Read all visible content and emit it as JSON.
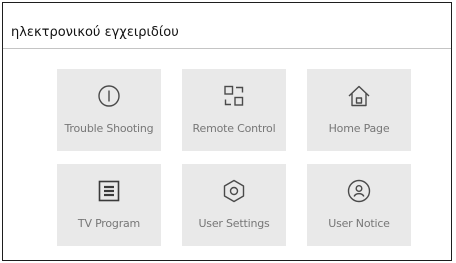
{
  "header": {
    "title": "ηλεκτρονικού εγχειριδίου"
  },
  "menu": {
    "items": [
      {
        "label": "Trouble Shooting",
        "icon": "trouble-shooting-icon"
      },
      {
        "label": "Remote Control",
        "icon": "remote-control-icon"
      },
      {
        "label": "Home Page",
        "icon": "home-icon"
      },
      {
        "label": "TV Program",
        "icon": "tv-program-icon"
      },
      {
        "label": "User Settings",
        "icon": "settings-hexagon-icon"
      },
      {
        "label": "User Notice",
        "icon": "user-notice-icon"
      }
    ]
  },
  "colors": {
    "tile_background": "#e9e9e9",
    "icon_stroke": "#4a4a4a",
    "label_text": "#777777",
    "frame_border": "#1e1e1e"
  }
}
